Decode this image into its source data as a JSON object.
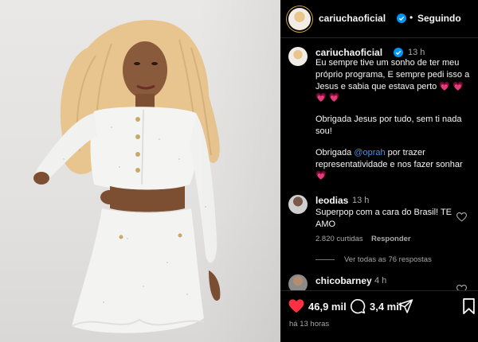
{
  "post": {
    "photo_alt": "Mulher com cabelo cacheado loiro em conjunto de tweed branco",
    "author": "cariuchaoficial",
    "follow_status": "Seguindo",
    "more": "•••"
  },
  "caption": {
    "username": "cariuchaoficial",
    "time": "13 h",
    "line1": "Eu sempre tive um sonho de ter meu",
    "line2": "próprio programa, E sempre pedi isso a",
    "line3": "Jesus e sabia que estava perto",
    "line3_emoji": "💗 💗",
    "line4_emoji": "💗 💗",
    "line5": "Obrigada Jesus por tudo, sem ti nada",
    "line6": "sou!",
    "line7_prefix": "Obrigada ",
    "line7_mention": "@oprah",
    "line7_suffix": " por trazer",
    "line8": "representatividade e nos fazer sonhar",
    "line9_emoji": "💗"
  },
  "comments": [
    {
      "username": "leodias",
      "time": "13 h",
      "line1": "Superpop com a cara do Brasil! TE",
      "line2": "AMO",
      "likes": "2.820 curtidas",
      "reply": "Responder",
      "view_replies": "Ver todas as 76 respostas"
    },
    {
      "username": "chicobarney",
      "time": "4 h"
    }
  ],
  "actions": {
    "likes": "46,9 mil",
    "comments": "3,4 mil",
    "posted": "há 13 horas"
  },
  "colors": {
    "accent_blue": "#0095f6",
    "heart_red": "#ff3040",
    "mention": "#4a90e2"
  }
}
